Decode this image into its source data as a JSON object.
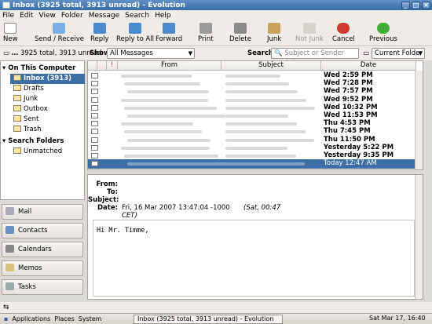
{
  "window": {
    "title": "Inbox (3925 total, 3913 unread) - Evolution"
  },
  "menu": [
    "File",
    "Edit",
    "View",
    "Folder",
    "Message",
    "Search",
    "Help"
  ],
  "toolbar": {
    "new": "New",
    "send_receive": "Send / Receive",
    "reply": "Reply",
    "reply_all": "Reply to All",
    "forward": "Forward",
    "print": "Print",
    "delete": "Delete",
    "junk": "Junk",
    "not_junk": "Not Junk",
    "cancel": "Cancel",
    "previous": "Previous"
  },
  "status_top": "3925 total, 3913 unread",
  "filter": {
    "show_label": "Show:",
    "show_value": "All Messages",
    "search_label": "Search:",
    "search_placeholder": "Subject or Sender contains",
    "scope": "Current Folder"
  },
  "folders": {
    "on_this_computer": "On This Computer",
    "items": [
      "Inbox (3913)",
      "Drafts",
      "Junk",
      "Outbox",
      "Sent",
      "Trash"
    ],
    "search_folders": "Search Folders",
    "search_items": [
      "Unmatched"
    ]
  },
  "switcher": [
    "Mail",
    "Contacts",
    "Calendars",
    "Memos",
    "Tasks"
  ],
  "columns": {
    "from": "From",
    "subject": "Subject",
    "date": "Date"
  },
  "messages": [
    {
      "date": "Wed 2:59 PM"
    },
    {
      "date": "Wed 7:28 PM"
    },
    {
      "date": "Wed 7:57 PM"
    },
    {
      "date": "Wed 9:52 PM"
    },
    {
      "date": "Wed 10:32 PM"
    },
    {
      "date": "Wed 11:53 PM"
    },
    {
      "date": "Thu 4:53 PM"
    },
    {
      "date": "Thu 7:45 PM"
    },
    {
      "date": "Thu 11:50 PM"
    },
    {
      "date": "Yesterday 5:22 PM"
    },
    {
      "date": "Yesterday 9:35 PM"
    },
    {
      "date": "Today 12:47 AM"
    }
  ],
  "preview": {
    "from_label": "From:",
    "to_label": "To:",
    "subject_label": "Subject:",
    "date_label": "Date:",
    "date_value": "Fri, 16 Mar 2007 13:47:04 -1000",
    "date_local": "(Sat, 00:47",
    "date_local2": "CET)",
    "greeting": "Hi Mr. Timme,"
  },
  "panel": {
    "applications": "Applications",
    "places": "Places",
    "system": "System",
    "clock": "Sat Mar 17, 16:40"
  }
}
